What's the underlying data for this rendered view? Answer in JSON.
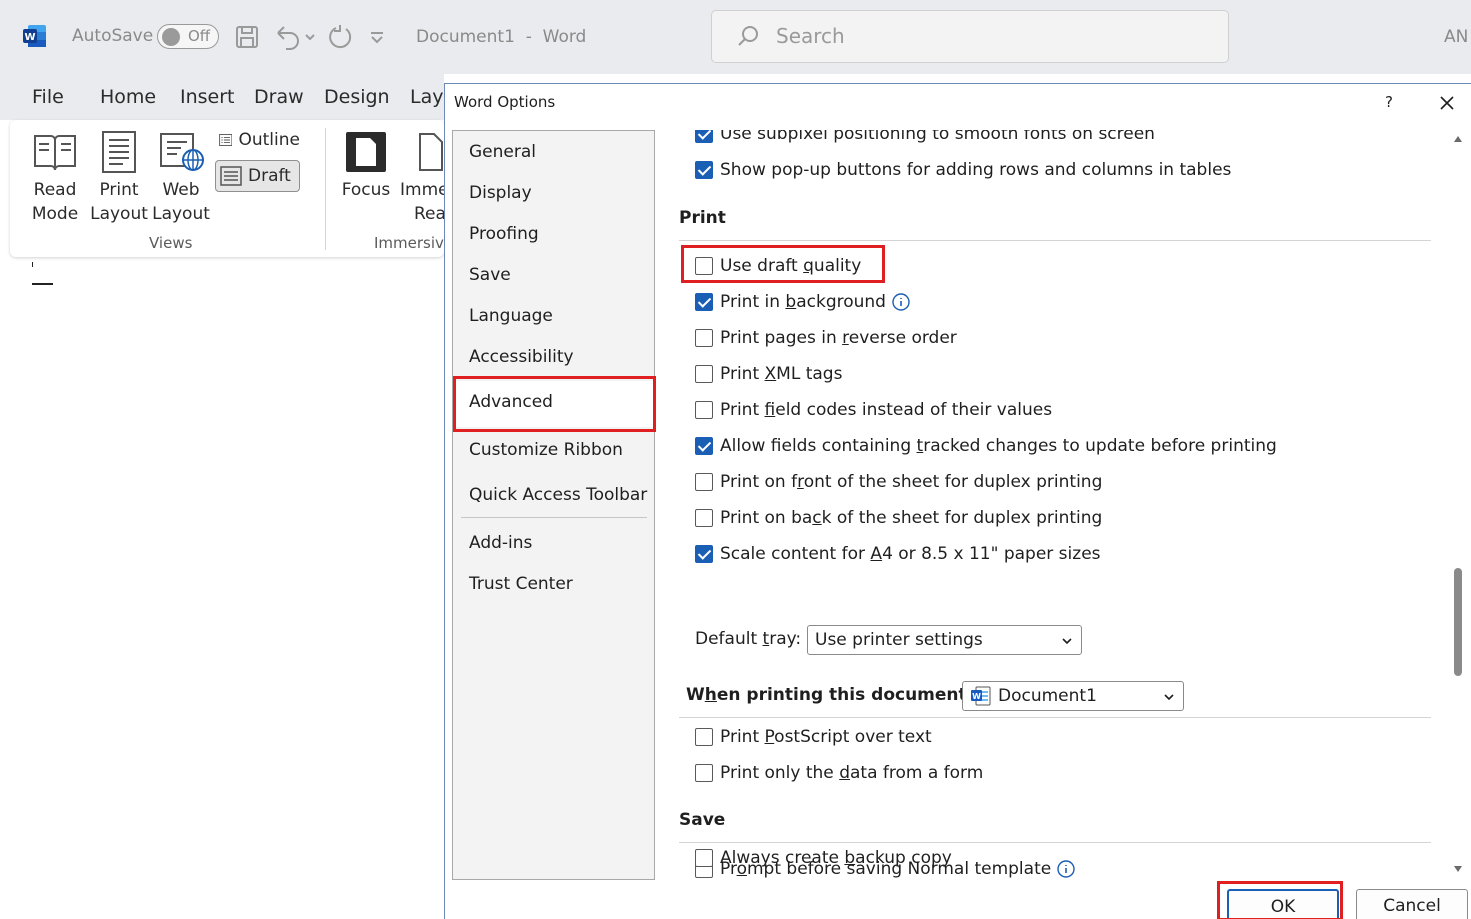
{
  "titlebar": {
    "autosave_label": "AutoSave",
    "autosave_state": "Off",
    "document_title": "Document1  -  Word",
    "search_placeholder": "Search",
    "user_initials": "AN"
  },
  "ribbon": {
    "tabs": [
      "File",
      "Home",
      "Insert",
      "Draw",
      "Design",
      "Layo"
    ],
    "views_group": {
      "label": "Views",
      "read_mode": [
        "Read",
        "Mode"
      ],
      "print_layout": [
        "Print",
        "Layout"
      ],
      "web_layout": [
        "Web",
        "Layout"
      ],
      "outline": "Outline",
      "draft": "Draft"
    },
    "immersive_group": {
      "label": "Immersive",
      "focus": "Focus",
      "immersive_reader": [
        "Imme",
        "Rea"
      ]
    }
  },
  "dialog": {
    "title": "Word Options",
    "help": "?",
    "nav": [
      "General",
      "Display",
      "Proofing",
      "Save",
      "Language",
      "Accessibility",
      "Advanced",
      "Customize Ribbon",
      "Quick Access Toolbar",
      "Add-ins",
      "Trust Center"
    ],
    "selected_nav": "Advanced",
    "top_options": [
      {
        "label": "Use subpixel positioning to smooth fonts on screen",
        "checked": true
      },
      {
        "label": "Show pop-up buttons for adding rows and columns in tables",
        "checked": true
      }
    ],
    "print_section": {
      "heading": "Print",
      "options": [
        {
          "pre": "Use draft ",
          "key": "q",
          "post": "uality",
          "checked": false
        },
        {
          "pre": "Print in ",
          "key": "b",
          "post": "ackground",
          "checked": true
        },
        {
          "pre": "Print pages in ",
          "key": "r",
          "post": "everse order",
          "checked": false
        },
        {
          "pre": "Print ",
          "key": "X",
          "post": "ML tags",
          "checked": false
        },
        {
          "pre": "Print ",
          "key": "f",
          "post": "ield codes instead of their values",
          "checked": false
        },
        {
          "pre": "Allow fields containing ",
          "key": "t",
          "post": "racked changes to update before printing",
          "checked": true
        },
        {
          "pre": "Print on f",
          "key": "r",
          "post": "ont of the sheet for duplex printing",
          "checked": false
        },
        {
          "pre": "Print on ba",
          "key": "c",
          "post": "k of the sheet for duplex printing",
          "checked": false
        },
        {
          "pre": "Scale content for ",
          "key": "A",
          "post": "4 or 8.5 x 11\" paper sizes",
          "checked": true
        }
      ],
      "default_tray_label_pre": "Default ",
      "default_tray_label_key": "t",
      "default_tray_label_post": "ray:",
      "default_tray_value": "Use printer settings"
    },
    "when_printing": {
      "label_pre": "W",
      "label_key": "h",
      "label_post": "en printing this document:",
      "document": "Document1",
      "options": [
        {
          "pre": "Print ",
          "key": "P",
          "post": "ostScript over text",
          "checked": false
        },
        {
          "pre": "Print only the ",
          "key": "d",
          "post": "ata from a form",
          "checked": false
        }
      ]
    },
    "save_section": {
      "heading": "Save",
      "options": [
        {
          "pre": "Pr",
          "key": "o",
          "post": "mpt before saving Normal template",
          "checked": false
        },
        {
          "pre": "Always create ",
          "key": "b",
          "post": "ackup copy",
          "checked": false
        }
      ]
    },
    "ok_label": "OK",
    "cancel_label": "Cancel"
  },
  "colors": {
    "accent": "#1a5fb4",
    "highlight": "#e02020",
    "word_blue": "#185abd"
  }
}
